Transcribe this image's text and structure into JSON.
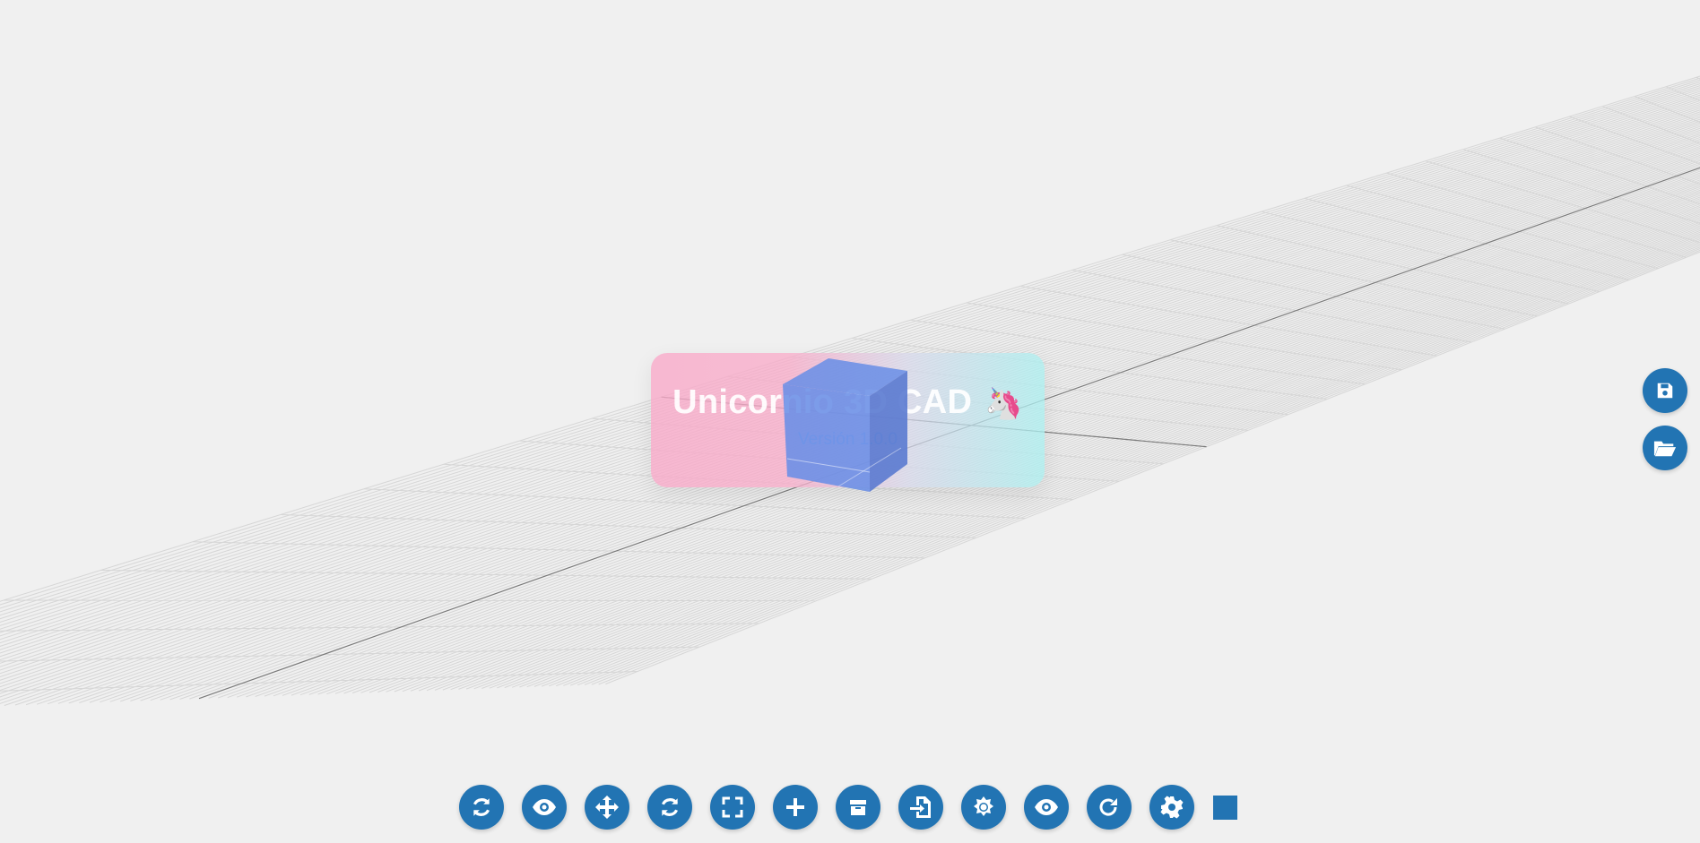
{
  "app": {
    "title": "Unicornio 3D CAD",
    "logo_icon": "unicorn-icon",
    "version": "Versión 1.0.0"
  },
  "colors": {
    "accent": "#2274b3",
    "background": "#f0f0f0",
    "grid_line": "#d6d6d6",
    "axis_line": "#7a7a7a",
    "cube": "#6a8ee6"
  },
  "side_buttons": [
    {
      "icon": "save-icon"
    },
    {
      "icon": "folder-open-icon"
    }
  ],
  "toolbar": {
    "buttons": [
      {
        "icon": "sync-icon"
      },
      {
        "icon": "eye-icon"
      },
      {
        "icon": "move-icon"
      },
      {
        "icon": "rotate-icon"
      },
      {
        "icon": "expand-icon"
      },
      {
        "icon": "plus-icon"
      },
      {
        "icon": "box-icon"
      },
      {
        "icon": "file-import-icon"
      },
      {
        "icon": "sun-icon"
      },
      {
        "icon": "eye-outline-icon"
      },
      {
        "icon": "redo-icon"
      },
      {
        "icon": "gear-icon"
      }
    ],
    "color_swatch": "#2274b3"
  }
}
